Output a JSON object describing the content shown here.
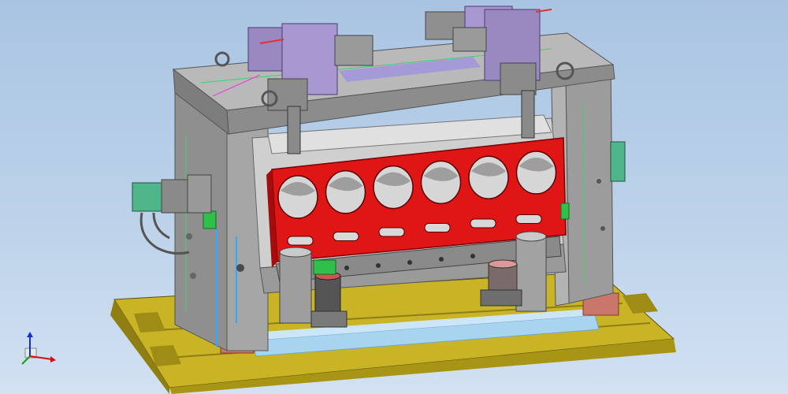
{
  "viewport": {
    "background_top": "#a9c4e2",
    "background_bottom": "#d2e1f2"
  },
  "colors": {
    "base_yellow": "#c9b426",
    "base_yellow_dark": "#8f7f12",
    "frame_gray": "#9a9a9a",
    "frame_gray_light": "#c2c2c2",
    "frame_gray_dark": "#6f6f6f",
    "block_red": "#e01515",
    "purple_clamp": "#9a88c0",
    "green_part": "#2fbf4a",
    "cyan_plate": "#a9d4f0",
    "salmon_pad": "#c9776a"
  },
  "model": {
    "cylinder_holes": 6,
    "lower_slots": 6
  },
  "triad": {
    "x_axis_color": "#d01010",
    "y_axis_color": "#10a010",
    "z_axis_color": "#1030d0",
    "icon": "coordinate-triad-icon"
  }
}
